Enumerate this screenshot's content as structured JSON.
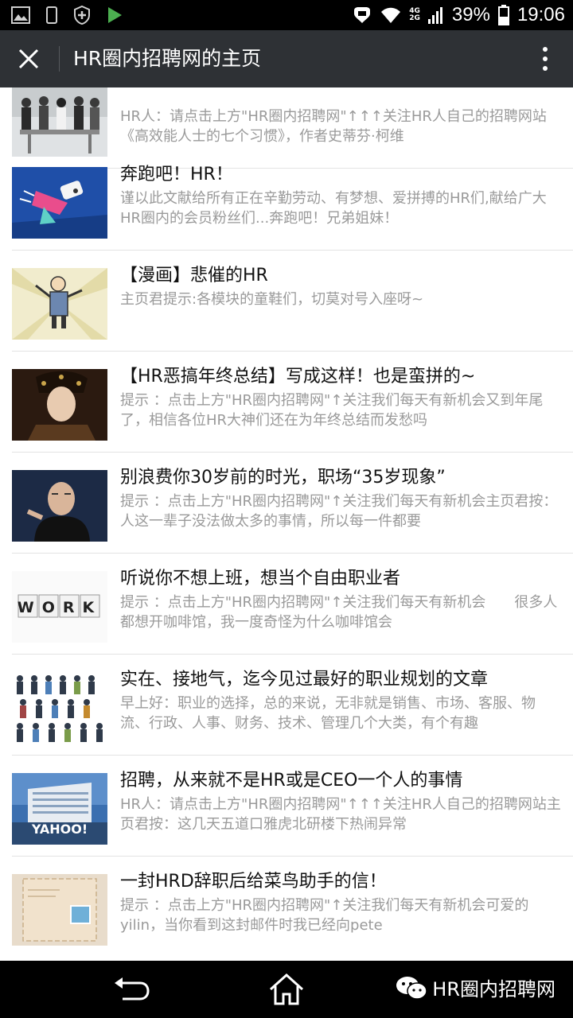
{
  "status_bar": {
    "network": "4G",
    "network2": "2G",
    "battery": "39%",
    "time": "19:06"
  },
  "title_bar": {
    "title": "HR圈内招聘网的主页"
  },
  "articles": [
    {
      "title": "",
      "desc": "HR人：请点击上方\"HR圈内招聘网\"↑↑↑关注HR人自己的招聘网站《高效能人士的七个习惯》，作者史蒂芬·柯维",
      "thumb": "meeting"
    },
    {
      "title": "奔跑吧！HR！",
      "desc": "谨以此文献给所有正在辛勤劳动、有梦想、爱拼搏的HR们,献给广大HR圈内的会员粉丝们...奔跑吧！兄弟姐妹！",
      "thumb": "cartoon"
    },
    {
      "title": "【漫画】悲催的HR",
      "desc": "主页君提示:各模块的童鞋们，切莫对号入座呀~",
      "thumb": "comic"
    },
    {
      "title": "【HR恶搞年终总结】写成这样！也是蛮拼的~",
      "desc": "提示 ：点击上方\"HR圈内招聘网\"↑关注我们每天有新机会又到年尾了，相信各位HR大神们还在为年终总结而发愁吗",
      "thumb": "portrait"
    },
    {
      "title": "别浪费你30岁前的时光，职场“35岁现象”",
      "desc": "提示 ：点击上方\"HR圈内招聘网\"↑关注我们每天有新机会主页君按：人这一辈子没法做太多的事情，所以每一件都要",
      "thumb": "speaker"
    },
    {
      "title": "听说你不想上班，想当个自由职业者",
      "desc": "提示 ：点击上方\"HR圈内招聘网\"↑关注我们每天有新机会　　很多人都想开咖啡馆，我一度奇怪为什么咖啡馆会",
      "thumb": "work"
    },
    {
      "title": "实在、接地气，迄今见过最好的职业规划的文章",
      "desc": "早上好：职业的选择，总的来说，无非就是销售、市场、客服、物流、行政、人事、财务、技术、管理几个大类，有个有趣",
      "thumb": "people"
    },
    {
      "title": "招聘，从来就不是HR或是CEO一个人的事情",
      "desc": "HR人：请点击上方\"HR圈内招聘网\"↑↑↑关注HR人自己的招聘网站主页君按：这几天五道口雅虎北研楼下热闹异常",
      "thumb": "yahoo"
    },
    {
      "title": "一封HRD辞职后给菜鸟助手的信！",
      "desc": "提示 ：点击上方\"HR圈内招聘网\"↑关注我们每天有新机会可爱的yilin，当你看到这封邮件时我已经向pete",
      "thumb": "letter"
    }
  ],
  "thumb_text": {
    "work": "WORK",
    "yahoo": "YAHOO!"
  },
  "watermark": {
    "text": "HR圈内招聘网"
  }
}
